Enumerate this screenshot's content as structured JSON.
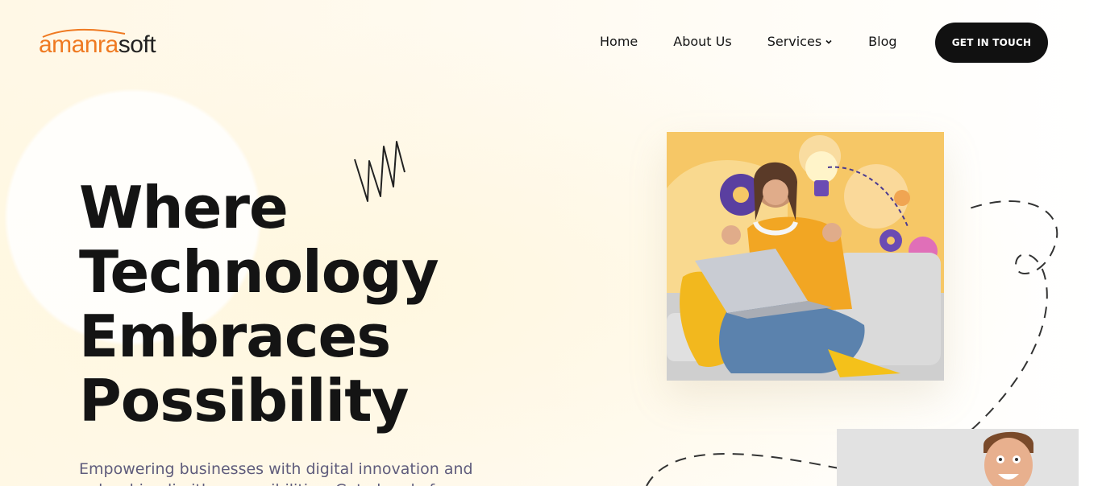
{
  "header": {
    "logo": {
      "part1": "amanra",
      "part2": "soft"
    },
    "nav": [
      {
        "label": "Home"
      },
      {
        "label": "About Us"
      },
      {
        "label": "Services",
        "has_dropdown": true
      },
      {
        "label": "Blog"
      }
    ],
    "cta_label": "GET IN TOUCH"
  },
  "hero": {
    "headline": [
      "Where",
      "Technology",
      "Embraces",
      "Possibility"
    ],
    "subtitle": "Empowering businesses with digital innovation and unleashing limitless possibilities. Get ahead of your"
  },
  "icons": {
    "services_dropdown": "chevron-down-icon",
    "scribble": "scribble-decoration",
    "dashed_path": "dashed-path-decoration"
  },
  "colors": {
    "brand_orange": "#ef7a22",
    "cta_background": "#111111",
    "headline": "#141414",
    "subtitle": "#5f5c7c",
    "photo_background": "#f6c766"
  }
}
